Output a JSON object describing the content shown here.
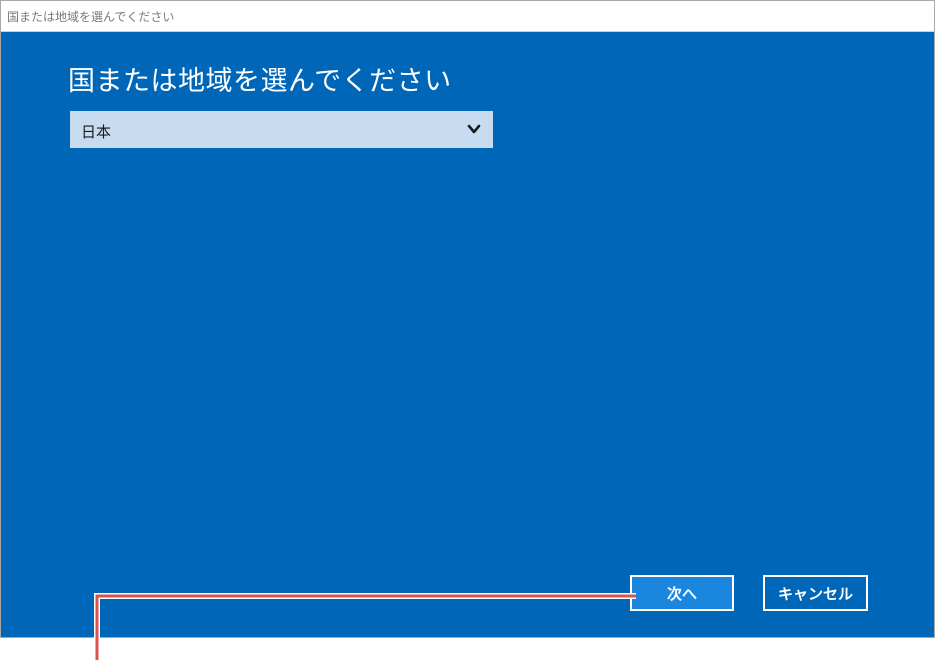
{
  "window": {
    "title": "国または地域を選んでください"
  },
  "main": {
    "heading": "国または地域を選んでください",
    "region_select": {
      "selected_value": "日本",
      "icon": "chevron-down-icon"
    }
  },
  "buttons": {
    "next_label": "次へ",
    "cancel_label": "キャンセル"
  },
  "colors": {
    "background": "#0067b8",
    "select_background": "#c7dcf1",
    "next_button": "#1a86dd",
    "callout_line": "#d9534f"
  }
}
